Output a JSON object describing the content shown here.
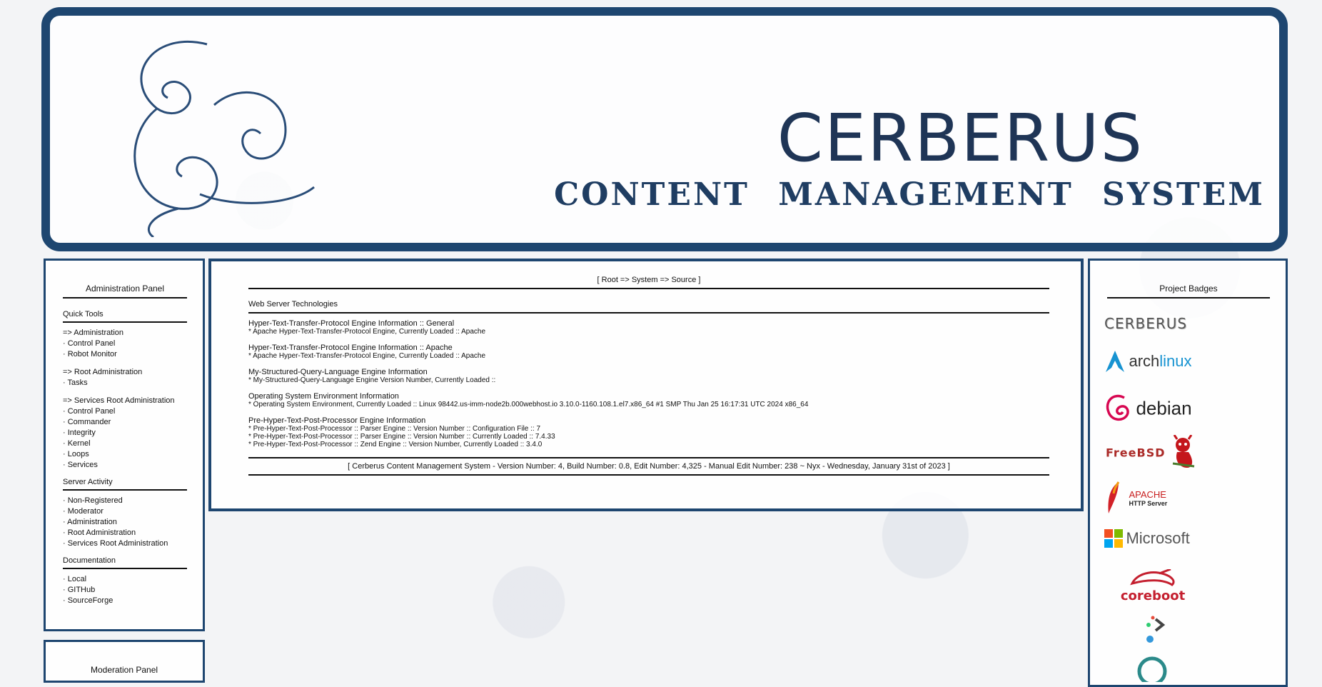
{
  "banner": {
    "title": "CERBERUS",
    "subtitle": "CONTENT MANAGEMENT SYSTEM",
    "accent_color": "#1e4670"
  },
  "admin_panel": {
    "title": "Administration Panel",
    "quick_tools_title": "Quick Tools",
    "items": [
      {
        "label": "=> Administration"
      },
      {
        "label": "· Control Panel"
      },
      {
        "label": "· Robot Monitor"
      },
      {
        "label": "=> Root Administration"
      },
      {
        "label": "· Tasks"
      },
      {
        "label": "=> Services Root Administration"
      },
      {
        "label": "· Control Panel"
      },
      {
        "label": "· Commander"
      },
      {
        "label": "· Integrity"
      },
      {
        "label": "· Kernel"
      },
      {
        "label": "· Loops"
      },
      {
        "label": "· Services"
      }
    ],
    "server_activity_title": "Server Activity",
    "server_activity": [
      {
        "label": "· Non-Registered"
      },
      {
        "label": "· Moderator"
      },
      {
        "label": "· Administration"
      },
      {
        "label": "· Root Administration"
      },
      {
        "label": "· Services Root Administration"
      }
    ],
    "documentation_title": "Documentation",
    "documentation": [
      {
        "label": "· Local"
      },
      {
        "label": "· GITHub"
      },
      {
        "label": "· SourceForge"
      }
    ]
  },
  "moderation_panel": {
    "title": "Moderation Panel"
  },
  "main": {
    "breadcrumb": "[ Root => System => Source ]",
    "section_title": "Web Server Technologies",
    "blocks": [
      {
        "heading": "Hyper-Text-Transfer-Protocol Engine Information :: General",
        "lines": [
          "* Apache Hyper-Text-Transfer-Protocol Engine, Currently Loaded :: Apache"
        ]
      },
      {
        "heading": "Hyper-Text-Transfer-Protocol Engine Information :: Apache",
        "lines": [
          "* Apache Hyper-Text-Transfer-Protocol Engine, Currently Loaded :: Apache"
        ]
      },
      {
        "heading": "My-Structured-Query-Language Engine Information",
        "lines": [
          "* My-Structured-Query-Language Engine Version Number, Currently Loaded ::"
        ]
      },
      {
        "heading": "Operating System Environment Information",
        "lines": [
          "* Operating System Environment, Currently Loaded :: Linux 98442.us-imm-node2b.000webhost.io 3.10.0-1160.108.1.el7.x86_64 #1 SMP Thu Jan 25 16:17:31 UTC 2024 x86_64"
        ]
      },
      {
        "heading": "Pre-Hyper-Text-Post-Processor Engine Information",
        "lines": [
          "* Pre-Hyper-Text-Post-Processor :: Parser Engine :: Version Number :: Configuration File :: 7",
          "* Pre-Hyper-Text-Post-Processor :: Parser Engine :: Version Number :: Currently Loaded :: 7.4.33",
          "* Pre-Hyper-Text-Post-Processor :: Zend Engine :: Version Number, Currently Loaded :: 3.4.0"
        ]
      }
    ],
    "footer": "[ Cerberus Content Management System - Version Number: 4, Build Number: 0.8, Edit Number: 4,325 - Manual Edit Number: 238 ~ Nyx - Wednesday, January 31st of 2023 ]"
  },
  "badges": {
    "title": "Project Badges",
    "cerberus": "CERBERUS",
    "arch_a": "arch",
    "arch_b": "linux",
    "debian": "debian",
    "freebsd": "FreeBSD",
    "apache": "APACHE",
    "apache_sub": "HTTP Server",
    "microsoft": "Microsoft",
    "coreboot": "coreboot"
  }
}
